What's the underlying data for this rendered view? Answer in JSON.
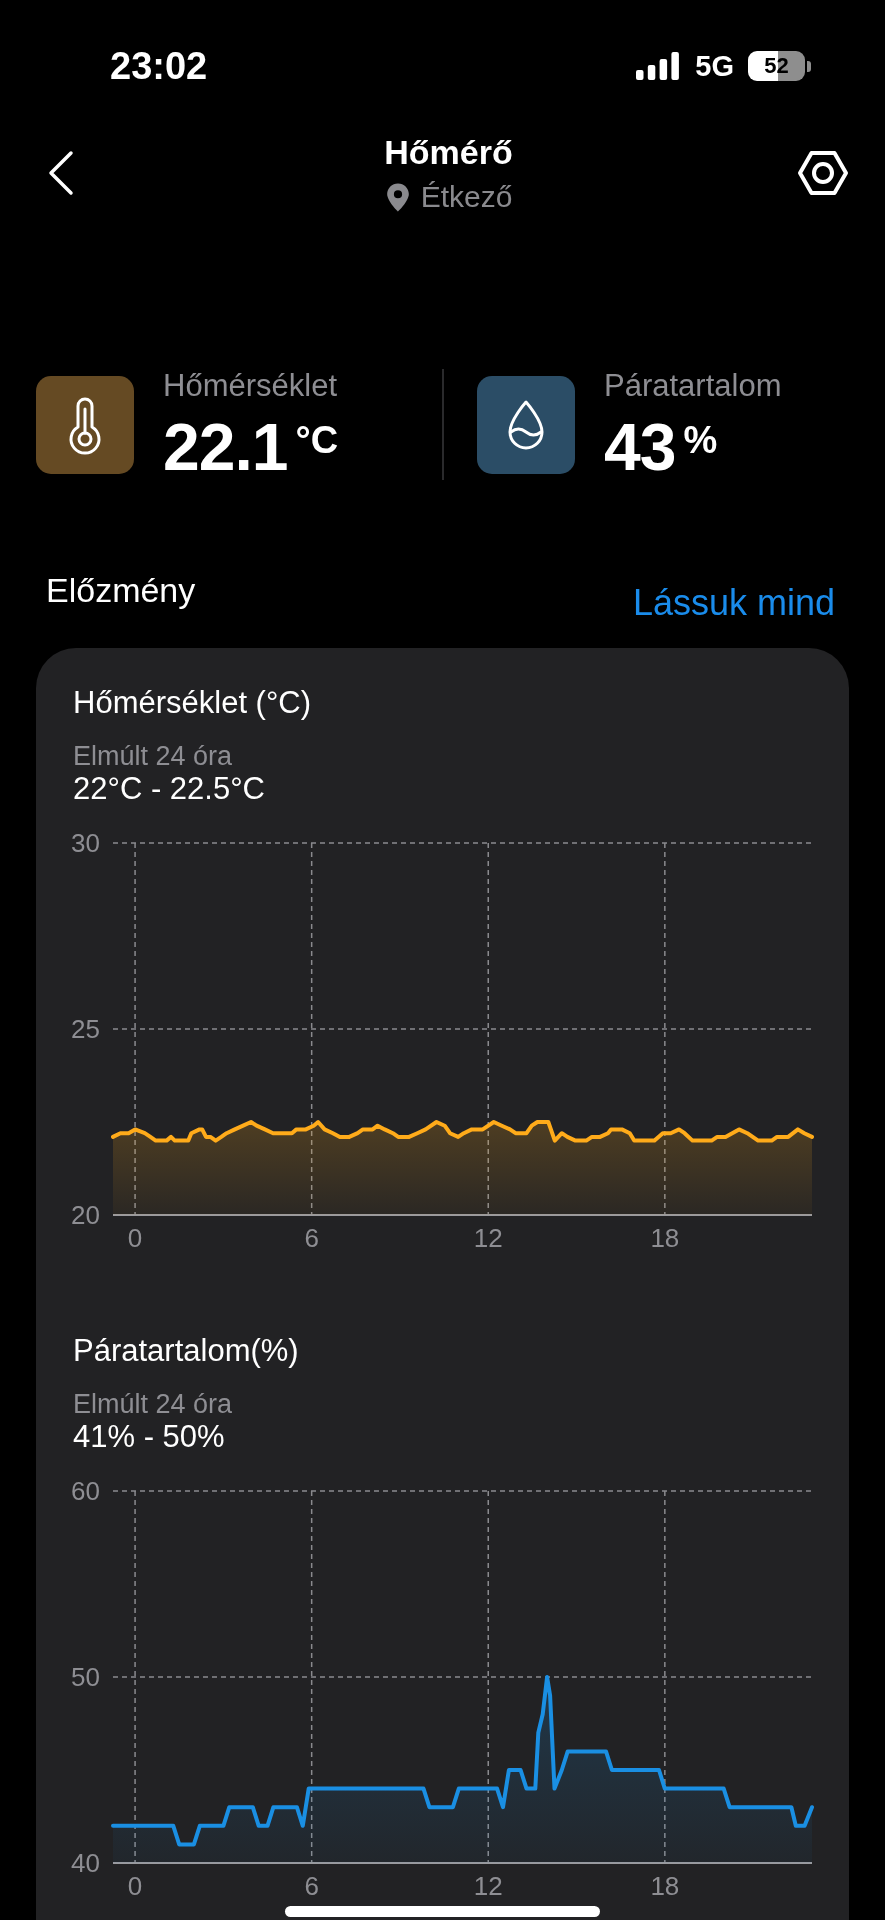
{
  "status_bar": {
    "time": "23:02",
    "network": "5G",
    "battery": "52"
  },
  "header": {
    "title": "Hőmérő",
    "location": "Étkező"
  },
  "metrics": [
    {
      "kind": "temperature",
      "color": "#654a23",
      "label": "Hőmérséklet",
      "value": "22.1",
      "unit": "°C"
    },
    {
      "kind": "humidity",
      "color": "#2b4d66",
      "label": "Páratartalom",
      "value": "43",
      "unit": "%"
    }
  ],
  "history": {
    "title": "Előzmény",
    "see_all": "Lássuk mind",
    "charts": [
      {
        "period": "Elmúlt 24 óra",
        "range": "22°C - 22.5°C",
        "chart_data": {
          "type": "area",
          "title": "Hőmérséklet (°C)",
          "x": [
            -0.75,
            -0.5,
            -0.22,
            0,
            0.33,
            0.52,
            0.7,
            1.07,
            1.22,
            1.35,
            1.81,
            1.91,
            2.19,
            2.28,
            2.41,
            2.56,
            2.74,
            2.93,
            3.11,
            3.39,
            3.67,
            3.94,
            4.13,
            4.41,
            4.69,
            5.33,
            5.48,
            5.8,
            6.07,
            6.22,
            6.44,
            6.72,
            6.96,
            7.28,
            7.56,
            7.74,
            8.07,
            8.24,
            8.48,
            8.76,
            8.94,
            9.31,
            9.59,
            9.87,
            10.24,
            10.52,
            10.7,
            10.98,
            11.17,
            11.44,
            11.81,
            12.19,
            12.46,
            12.74,
            12.93,
            13.3,
            13.48,
            13.67,
            14.04,
            14.13,
            14.26,
            14.5,
            14.69,
            14.96,
            15.33,
            15.52,
            15.8,
            16.07,
            16.17,
            16.54,
            16.81,
            16.96,
            17.65,
            17.93,
            18.2,
            18.48,
            18.67,
            18.94,
            19.59,
            19.78,
            20.06,
            20.52,
            20.8,
            21.17,
            21.63,
            21.81,
            22.19,
            22.52,
            22.74,
            23
          ],
          "series": [
            {
              "color": "#ffab1a",
              "values": [
                22.1,
                22.2,
                22.2,
                22.3,
                22.2,
                22.1,
                22.0,
                22.0,
                22.1,
                22.0,
                22.0,
                22.2,
                22.3,
                22.3,
                22.1,
                22.1,
                22.0,
                22.1,
                22.2,
                22.3,
                22.4,
                22.5,
                22.4,
                22.3,
                22.2,
                22.2,
                22.3,
                22.3,
                22.4,
                22.5,
                22.3,
                22.2,
                22.1,
                22.1,
                22.2,
                22.3,
                22.3,
                22.4,
                22.3,
                22.2,
                22.1,
                22.1,
                22.2,
                22.3,
                22.5,
                22.4,
                22.2,
                22.1,
                22.2,
                22.3,
                22.3,
                22.5,
                22.4,
                22.3,
                22.2,
                22.2,
                22.4,
                22.5,
                22.5,
                22.3,
                22.0,
                22.2,
                22.1,
                22.0,
                22.0,
                22.1,
                22.1,
                22.2,
                22.3,
                22.3,
                22.2,
                22.0,
                22.0,
                22.2,
                22.2,
                22.3,
                22.2,
                22.0,
                22.0,
                22.1,
                22.1,
                22.3,
                22.2,
                22.0,
                22.0,
                22.1,
                22.1,
                22.3,
                22.2,
                22.1
              ]
            }
          ],
          "xlim": [
            -0.75,
            23
          ],
          "ylim": [
            20,
            30
          ],
          "xticks": [
            0,
            6,
            12,
            18
          ],
          "yticks": [
            20,
            25,
            30
          ],
          "grid": true
        }
      },
      {
        "period": "Elmúlt 24 óra",
        "range": "41% - 50%",
        "chart_data": {
          "type": "area",
          "title": "Páratartalom(%)",
          "x": [
            -0.75,
            1.3,
            1.5,
            2.0,
            2.2,
            3.0,
            3.2,
            4.0,
            4.2,
            4.5,
            4.7,
            5.5,
            5.7,
            5.9,
            9.8,
            10.0,
            10.8,
            11.0,
            12.3,
            12.5,
            12.7,
            13.1,
            13.3,
            13.6,
            13.7,
            13.85,
            14.0,
            14.1,
            14.25,
            14.5,
            14.7,
            16.0,
            16.2,
            17.8,
            18.0,
            20.0,
            20.2,
            22.3,
            22.45,
            22.75,
            23.0
          ],
          "series": [
            {
              "color": "#1a8fe3",
              "values": [
                42,
                42,
                41,
                41,
                42,
                42,
                43,
                43,
                42,
                42,
                43,
                43,
                42,
                44,
                44,
                43,
                43,
                44,
                44,
                43,
                45,
                45,
                44,
                44,
                47,
                48,
                50,
                49,
                44,
                45,
                46,
                46,
                45,
                45,
                44,
                44,
                43,
                43,
                42,
                42,
                43
              ]
            }
          ],
          "xlim": [
            -0.75,
            23
          ],
          "ylim": [
            40,
            60
          ],
          "xticks": [
            0,
            6,
            12,
            18
          ],
          "yticks": [
            40,
            50,
            60
          ],
          "grid": true
        }
      }
    ]
  }
}
